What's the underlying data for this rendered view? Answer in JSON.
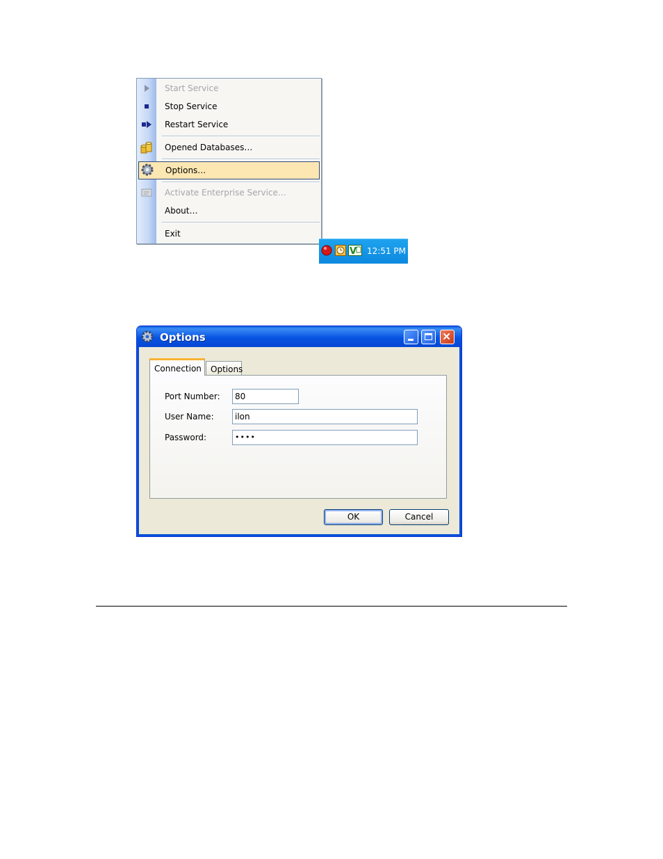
{
  "context_menu": {
    "items": [
      {
        "label": "Start Service",
        "icon": "play-icon",
        "enabled": false
      },
      {
        "label": "Stop Service",
        "icon": "stop-icon",
        "enabled": true
      },
      {
        "label": "Restart Service",
        "icon": "restart-icon",
        "enabled": true
      },
      {
        "label": "Opened Databases…",
        "icon": "database-icon",
        "enabled": true
      },
      {
        "label": "Options…",
        "icon": "gear-icon",
        "enabled": true,
        "highlighted": true
      },
      {
        "label": "Activate Enterprise Service…",
        "icon": "license-icon",
        "enabled": false
      },
      {
        "label": "About…",
        "icon": "",
        "enabled": true
      },
      {
        "label": "Exit",
        "icon": "",
        "enabled": true
      }
    ]
  },
  "tray": {
    "clock": "12:51 PM",
    "icons": [
      "red-ball-icon",
      "clock-icon",
      "vs-icon"
    ]
  },
  "dialog": {
    "title": "Options",
    "tabs": [
      {
        "label": "Connection",
        "active": true
      },
      {
        "label": "Options",
        "active": false
      }
    ],
    "fields": {
      "port_label": "Port Number:",
      "port_value": "80",
      "user_label": "User Name:",
      "user_value": "ilon",
      "password_label": "Password:",
      "password_value": "••••"
    },
    "ok_label": "OK",
    "cancel_label": "Cancel"
  },
  "colors": {
    "highlight": "#fce7b3",
    "titlebar": "#0854e3",
    "tray": "#1593e6",
    "tab_accent": "#f8b434"
  }
}
